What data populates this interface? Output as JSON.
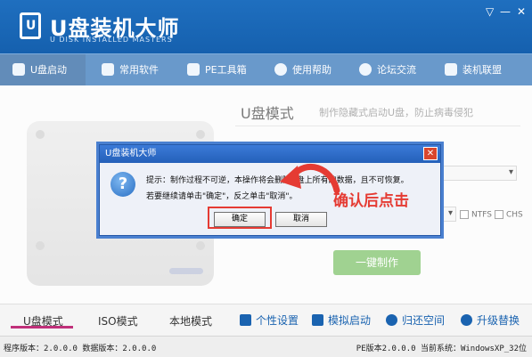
{
  "app": {
    "title": "U盘装机大师",
    "subtitle": "U DISK INSTALLED MASTERS",
    "logo_letter": "U",
    "window_controls": [
      "▽",
      "—",
      "✕"
    ]
  },
  "nav": {
    "items": [
      {
        "label": "U盘启动",
        "icon": "usb-icon"
      },
      {
        "label": "常用软件",
        "icon": "software-icon"
      },
      {
        "label": "PE工具箱",
        "icon": "toolbox-icon"
      },
      {
        "label": "使用帮助",
        "icon": "help-icon"
      },
      {
        "label": "论坛交流",
        "icon": "forum-icon"
      },
      {
        "label": "装机联盟",
        "icon": "alliance-icon"
      }
    ]
  },
  "main": {
    "mode_title": "U盘模式",
    "mode_desc": "制作隐藏式启动U盘，防止病毒侵犯",
    "options": [
      "NTFS",
      "CHS"
    ],
    "make_button": "一键制作"
  },
  "tabs": [
    {
      "label": "U盘模式"
    },
    {
      "label": "ISO模式"
    },
    {
      "label": "本地模式"
    }
  ],
  "tools": [
    {
      "label": "个性设置",
      "icon": "settings-icon"
    },
    {
      "label": "模拟启动",
      "icon": "simulate-icon"
    },
    {
      "label": "归还空间",
      "icon": "restore-icon"
    },
    {
      "label": "升级替换",
      "icon": "upgrade-icon"
    }
  ],
  "status": {
    "left": "程序版本：2.0.0.0  数据版本：2.0.0.0",
    "right": "PE版本2.0.0.0 当前系统：WindowsXP_32位"
  },
  "dialog": {
    "title": "U盘装机大师",
    "close": "✕",
    "icon": "question-icon",
    "line1": "提示：制作过程不可逆，本操作将会删除U盘上所有的数据，且不可恢复。",
    "line2": "若要继续请单击\"确定\"，反之单击\"取消\"。",
    "ok": "确定",
    "cancel": "取消"
  },
  "annotation": {
    "text": "确认后点击",
    "color": "#e53b33"
  },
  "colors": {
    "brand_blue": "#1a63b0",
    "make_green": "#6dbb57",
    "tab_accent": "#c0307a"
  }
}
